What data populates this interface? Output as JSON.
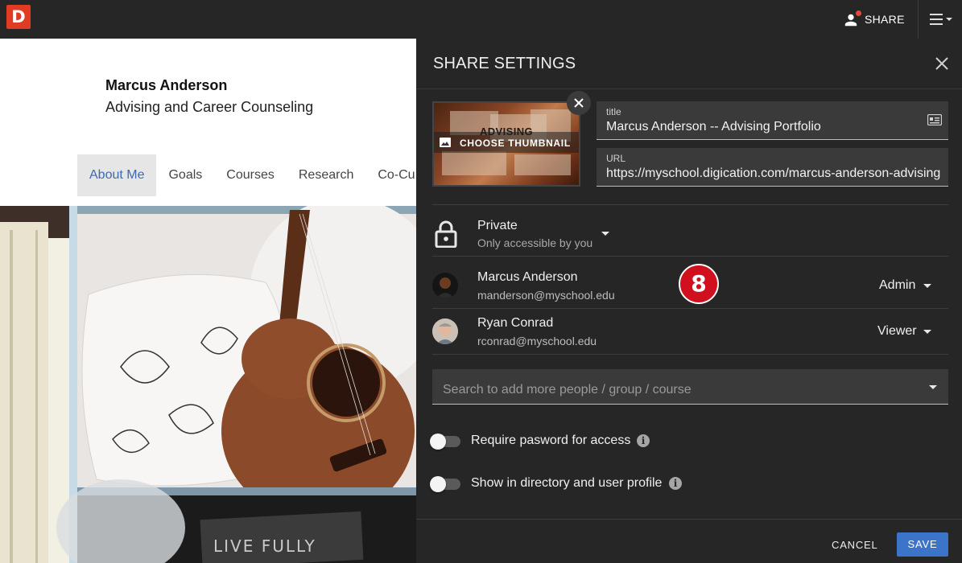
{
  "topbar": {
    "logo": "D",
    "share_label": "SHARE"
  },
  "page": {
    "owner_name": "Marcus Anderson",
    "owner_subtitle": "Advising and Career Counseling",
    "nav": [
      "About Me",
      "Goals",
      "Courses",
      "Research",
      "Co-Cu"
    ],
    "hero_text": "LIVE FULLY"
  },
  "share": {
    "title": "SHARE SETTINGS",
    "thumbnail": {
      "image_text": "ADVISING",
      "action": "CHOOSE THUMBNAIL"
    },
    "title_field": {
      "label": "title",
      "value": "Marcus Anderson -- Advising Portfolio"
    },
    "url_field": {
      "label": "URL",
      "value": "https://myschool.digication.com/marcus-anderson-advising"
    },
    "privacy": {
      "title": "Private",
      "subtitle": "Only accessible by you"
    },
    "people": [
      {
        "name": "Marcus Anderson",
        "email": "manderson@myschool.edu",
        "role": "Admin"
      },
      {
        "name": "Ryan Conrad",
        "email": "rconrad@myschool.edu",
        "role": "Viewer"
      }
    ],
    "step_badge": "8",
    "search_placeholder": "Search to add more people / group / course",
    "toggles": [
      {
        "label": "Require pasword for access",
        "on": false
      },
      {
        "label": "Show in directory and user profile",
        "on": false
      }
    ],
    "info_glyph": "i",
    "cancel_label": "CANCEL",
    "save_label": "SAVE"
  },
  "colors": {
    "accent": "#3b74c9",
    "logo": "#e03c24",
    "badge": "#d0101f",
    "panel_bg": "#262626"
  },
  "icons": [
    "person-icon",
    "notification-dot",
    "hamburger-icon",
    "close-icon",
    "image-icon",
    "id-card-icon",
    "lock-icon",
    "chevron-down-icon",
    "info-icon"
  ]
}
